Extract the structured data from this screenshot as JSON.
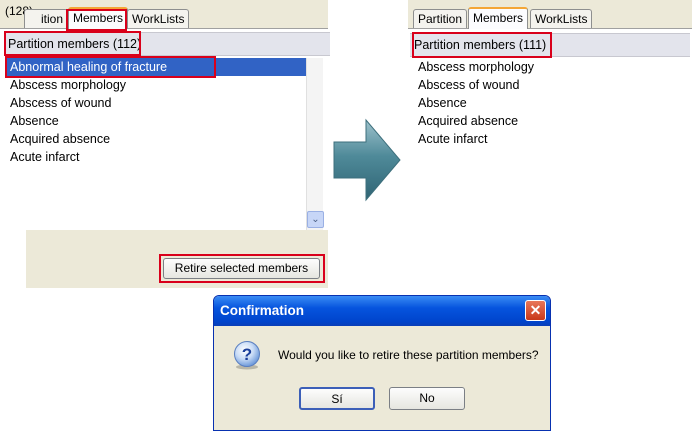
{
  "left": {
    "tabs": {
      "count_partial": "(128)",
      "partition_partial": "ition",
      "members": "Members",
      "worklists": "WorkLists"
    },
    "header": "Partition members (112)",
    "items": [
      "Abnormal healing of fracture",
      "Abscess morphology",
      "Abscess of wound",
      "Absence",
      "Acquired absence",
      "Acute infarct"
    ],
    "retire_button": "Retire selected members",
    "scroll_down_glyph": "⌄"
  },
  "right": {
    "tabs": {
      "partition": "Partition",
      "members": "Members",
      "worklists": "WorkLists"
    },
    "header": "Partition members (111)",
    "items": [
      "Abscess morphology",
      "Abscess of wound",
      "Absence",
      "Acquired absence",
      "Acute infarct"
    ]
  },
  "dialog": {
    "title": "Confirmation",
    "close_glyph": "✕",
    "message": "Would you like to retire these partition members?",
    "yes_label": "Sí",
    "no_label": "No",
    "icon": "question-icon"
  },
  "colors": {
    "highlight_box": "#d9001b",
    "selection": "#3163c5",
    "titlebar": "#0654de",
    "active_tab_accent": "#f4a637"
  }
}
